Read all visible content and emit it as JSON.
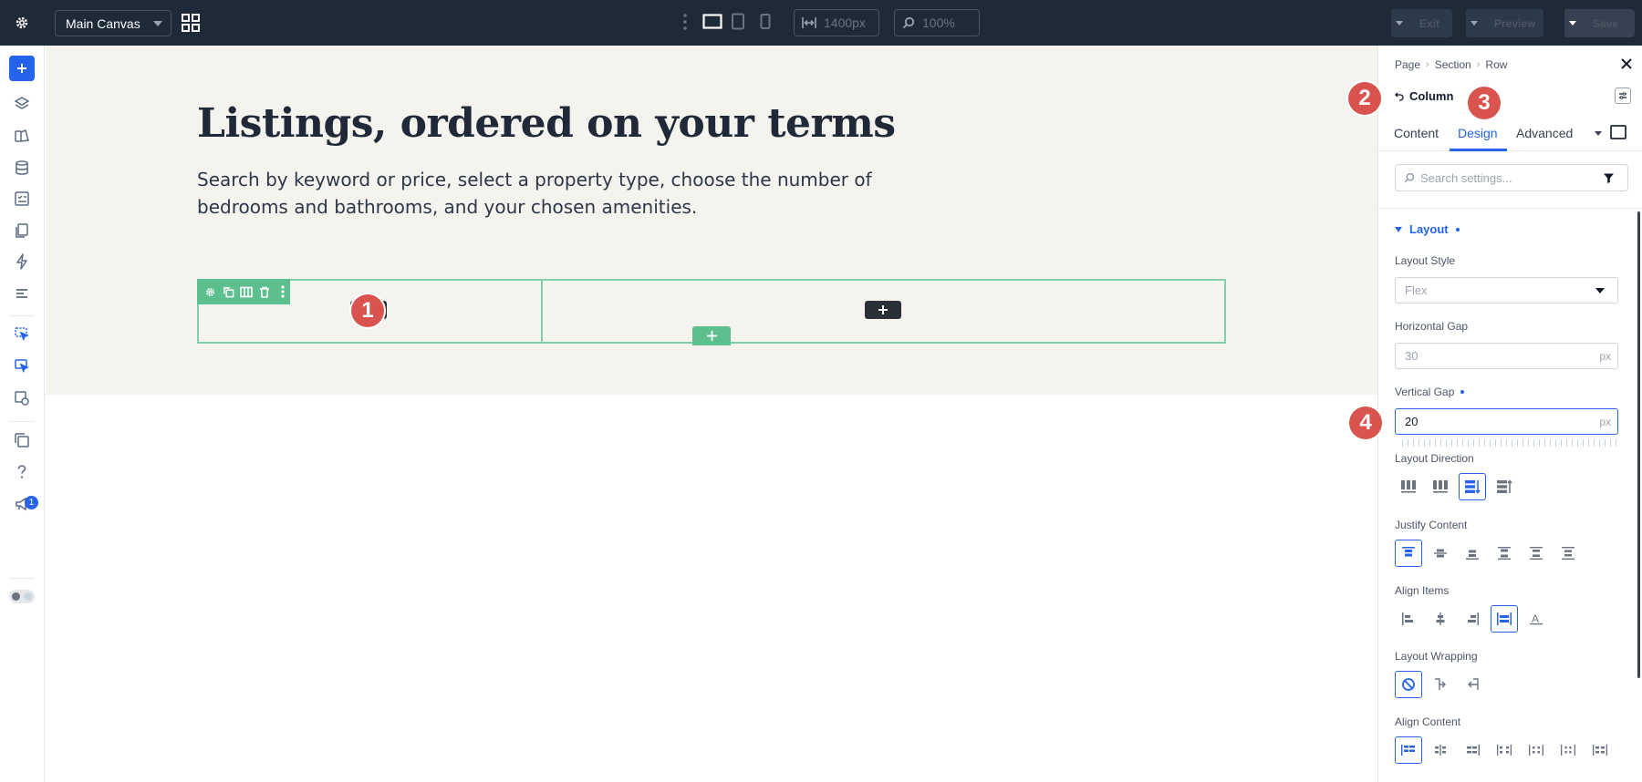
{
  "topbar": {
    "canvas_name": "Main Canvas",
    "width_value": "1400px",
    "zoom_value": "100%",
    "exit_label": "Exit",
    "preview_label": "Preview",
    "save_label": "Save"
  },
  "rail": {
    "notification_count": "1"
  },
  "canvas": {
    "heading": "Listings, ordered on your terms",
    "description": "Search by keyword or price, select a property type, choose the number of bedrooms and bathrooms, and your chosen amenities."
  },
  "markers": [
    "1",
    "2",
    "3",
    "4"
  ],
  "panel": {
    "breadcrumb": [
      "Page",
      "Section",
      "Row"
    ],
    "module_title": "Column",
    "tabs": [
      "Content",
      "Design",
      "Advanced"
    ],
    "active_tab": "Design",
    "search_placeholder": "Search settings...",
    "section_title": "Layout",
    "layout_style_label": "Layout Style",
    "layout_style_value": "Flex",
    "horizontal_gap_label": "Horizontal Gap",
    "horizontal_gap_value": "30",
    "horizontal_gap_unit": "px",
    "vertical_gap_label": "Vertical Gap",
    "vertical_gap_value": "20",
    "vertical_gap_unit": "px",
    "layout_direction_label": "Layout Direction",
    "justify_content_label": "Justify Content",
    "align_items_label": "Align Items",
    "layout_wrapping_label": "Layout Wrapping",
    "align_content_label": "Align Content"
  },
  "colors": {
    "accent": "#2563eb",
    "topbar_bg": "#1f2a38",
    "row_outline": "#7fcfa9",
    "marker": "#d9534f",
    "hero_bg": "#f5f3ee"
  }
}
